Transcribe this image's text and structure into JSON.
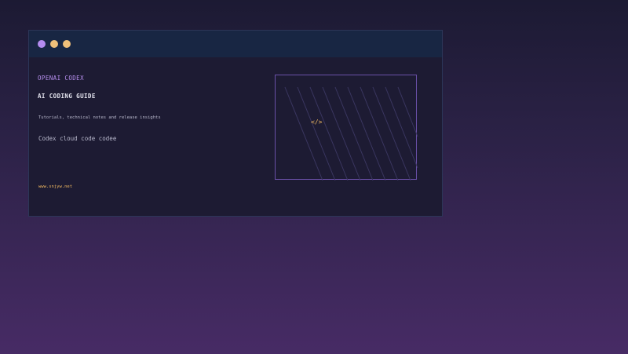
{
  "window": {
    "dots": [
      {
        "name": "dot-purple",
        "color": "#b48cf0"
      },
      {
        "name": "dot-yellow-1",
        "color": "#f0c07a"
      },
      {
        "name": "dot-yellow-2",
        "color": "#f0c07a"
      }
    ]
  },
  "content": {
    "eyebrow": "OPENAI CODEX",
    "title": "AI CODING GUIDE",
    "subtitle": "Tutorials, technical notes and release insights",
    "body": "Codex cloud code codee",
    "url": "www.snjyw.net"
  },
  "panel": {
    "glyph": "</>",
    "icon": "code-icon"
  },
  "colors": {
    "accent_purple": "#b890f0",
    "accent_gold": "#f0b860",
    "titlebar": "#182643",
    "window_bg": "#1d1b33"
  }
}
